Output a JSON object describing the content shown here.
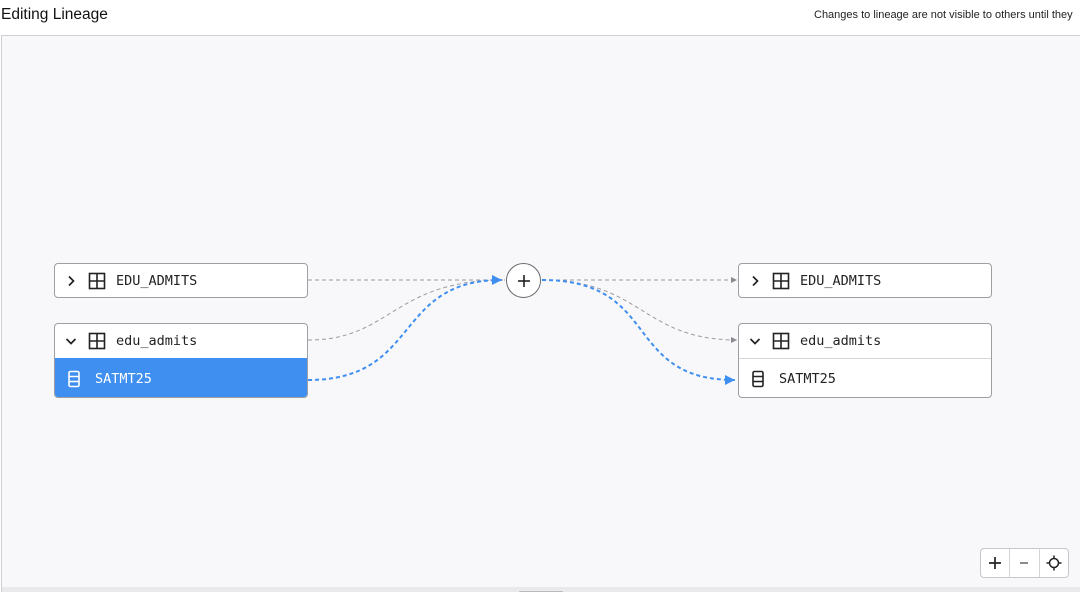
{
  "header": {
    "title": "Editing Lineage",
    "notice": "Changes to lineage are not visible to others until they"
  },
  "colors": {
    "accent": "#3f8ff0",
    "edge_dashed": "#9a9aa0",
    "canvas_bg": "#f8f8fa"
  },
  "left": {
    "table1": {
      "name": "EDU_ADMITS",
      "expanded": false
    },
    "table2": {
      "name": "edu_admits",
      "expanded": true,
      "columns": [
        {
          "name": "SATMT25",
          "selected": true
        }
      ]
    }
  },
  "right": {
    "table1": {
      "name": "EDU_ADMITS",
      "expanded": false
    },
    "table2": {
      "name": "edu_admits",
      "expanded": true,
      "columns": [
        {
          "name": "SATMT25",
          "selected": false
        }
      ]
    }
  },
  "center": {
    "icon": "plus-icon"
  },
  "zoom": {
    "zoom_in_icon": "plus-icon",
    "zoom_out_icon": "minus-icon",
    "recenter_icon": "crosshair-icon"
  }
}
